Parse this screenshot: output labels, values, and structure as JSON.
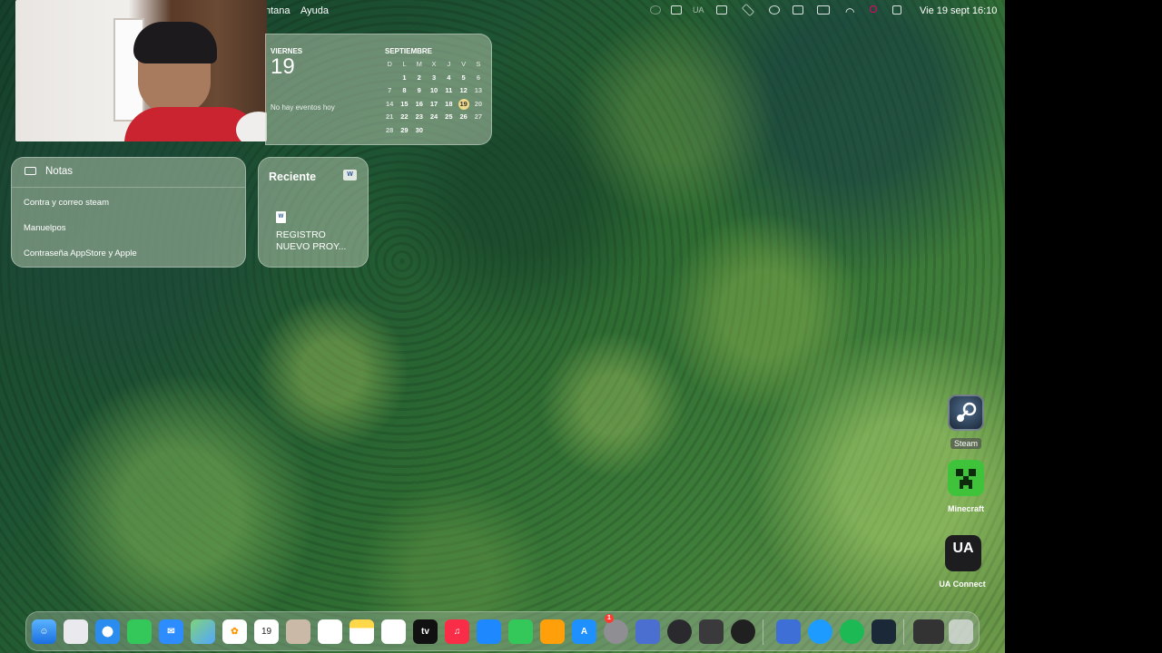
{
  "menubar": {
    "items": [
      "ntana",
      "Ayuda"
    ],
    "status_ua": "UA",
    "clock": "Vie 19 sept 16:10"
  },
  "calendar_widget": {
    "weekday": "VIERNES",
    "date": "19",
    "no_events": "No hay eventos hoy",
    "month": "SEPTIEMBRE",
    "day_headers": [
      "D",
      "L",
      "M",
      "X",
      "J",
      "V",
      "S"
    ],
    "weeks": [
      [
        "",
        "1",
        "2",
        "3",
        "4",
        "5",
        "6"
      ],
      [
        "7",
        "8",
        "9",
        "10",
        "11",
        "12",
        "13"
      ],
      [
        "14",
        "15",
        "16",
        "17",
        "18",
        "19",
        "20"
      ],
      [
        "21",
        "22",
        "23",
        "24",
        "25",
        "26",
        "27"
      ],
      [
        "28",
        "29",
        "30",
        "",
        "",
        "",
        ""
      ]
    ],
    "today": "19"
  },
  "notes_widget": {
    "title": "Notas",
    "items": [
      "Contra y correo steam",
      "Manuelpos",
      "Contraseña AppStore y Apple"
    ]
  },
  "recent_widget": {
    "title": "Reciente",
    "app_icon": "W",
    "file_line1": "REGISTRO",
    "file_line2": "NUEVO PROY..."
  },
  "desktop_icons": {
    "steam": "Steam",
    "minecraft": "Minecraft",
    "ua_connect": "UA Connect",
    "ua_glyph": "UA"
  },
  "dock": {
    "calendar_day": "19",
    "tv_label": "tv",
    "settings_badge": "1"
  },
  "colors": {
    "today_highlight": "#f1d98a",
    "forest_dark": "#16402c",
    "forest_light": "#6e9a4a"
  }
}
